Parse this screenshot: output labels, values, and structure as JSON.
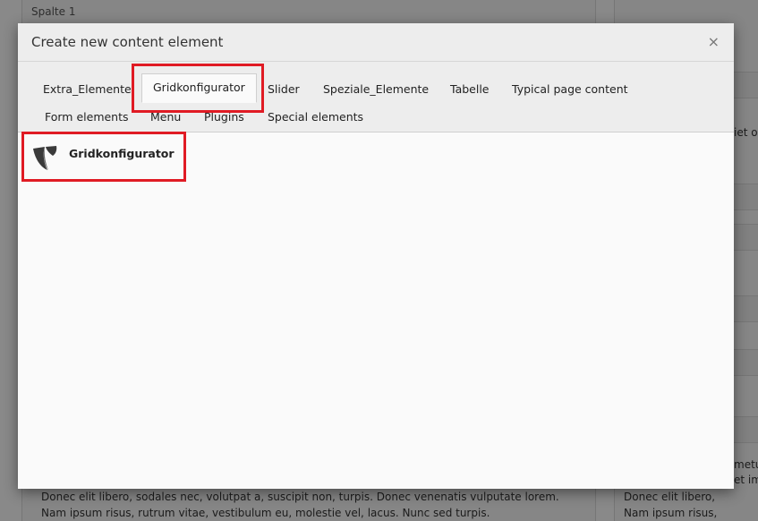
{
  "background": {
    "column_label": "Spalte 1",
    "snippet_right_1": "iet o",
    "snippet_right_2": "metu",
    "snippet_right_3": "et im",
    "left_text_line1": "Donec elit libero, sodales nec, volutpat a, suscipit non, turpis. Donec venenatis vulputate lorem.",
    "left_text_line2": "Nam ipsum risus, rutrum vitae, vestibulum eu, molestie vel, lacus. Nunc sed turpis.",
    "right_text_line1": "Donec elit libero,",
    "right_text_line2": "Nam ipsum risus,"
  },
  "modal": {
    "title": "Create new content element",
    "close_symbol": "×",
    "tabs_row1": [
      "Extra_Elemente",
      "Gridkonfigurator",
      "Slider",
      "Speziale_Elemente",
      "Tabelle",
      "Typical page content"
    ],
    "tabs_row2": [
      "Form elements",
      "Menu",
      "Plugins",
      "Special elements"
    ],
    "active_tab": "Gridkonfigurator",
    "elements": [
      {
        "label": "Gridkonfigurator",
        "icon": "typo3-logo-icon"
      }
    ]
  },
  "colors": {
    "highlight": "#e01b24"
  }
}
